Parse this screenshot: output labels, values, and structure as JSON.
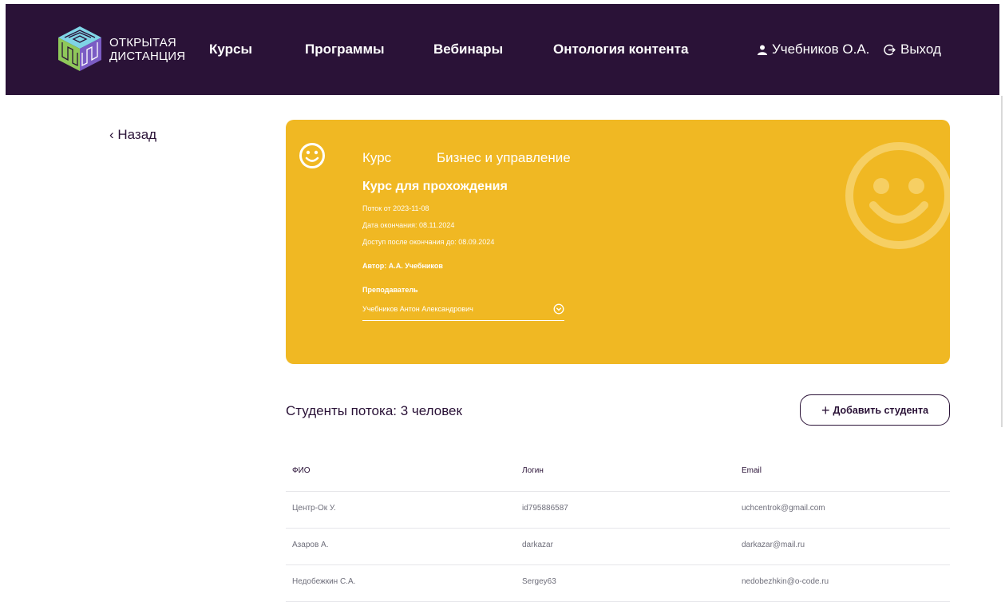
{
  "header": {
    "logo_line1": "ОТКРЫТАЯ",
    "logo_line2": "ДИСТАНЦИЯ",
    "nav": [
      {
        "label": "Курсы"
      },
      {
        "label": "Программы"
      },
      {
        "label": "Вебинары"
      },
      {
        "label": "Онтология контента"
      }
    ],
    "user_name": "Учебников О.А.",
    "logout_label": "Выход",
    "background_color": "#2a1237"
  },
  "back_label": "‹ Назад",
  "course_card": {
    "type_label": "Курс",
    "category": "Бизнес и управление",
    "title": "Курс для прохождения",
    "stream": "Поток от 2023-11-08",
    "end_date": "Дата окончания: 08.11.2024",
    "access_until": "Доступ после окончания до: 08.09.2024",
    "author": "Автор: А.А. Учебников",
    "teacher_label": "Преподаватель",
    "teacher_value": "Учебников Антон Александрович",
    "background_color": "#f0b823"
  },
  "students": {
    "title": "Студенты потока: 3 человек",
    "add_button_label": "Добавить студента",
    "columns": [
      "ФИО",
      "Логин",
      "Email"
    ],
    "rows": [
      [
        "Центр-Ок У.",
        "id795886587",
        "uchcentrok@gmail.com"
      ],
      [
        "Азаров А.",
        "darkazar",
        "darkazar@mail.ru"
      ],
      [
        "Недобежкин С.А.",
        "Sergey63",
        "nedobezhkin@o-code.ru"
      ]
    ]
  }
}
